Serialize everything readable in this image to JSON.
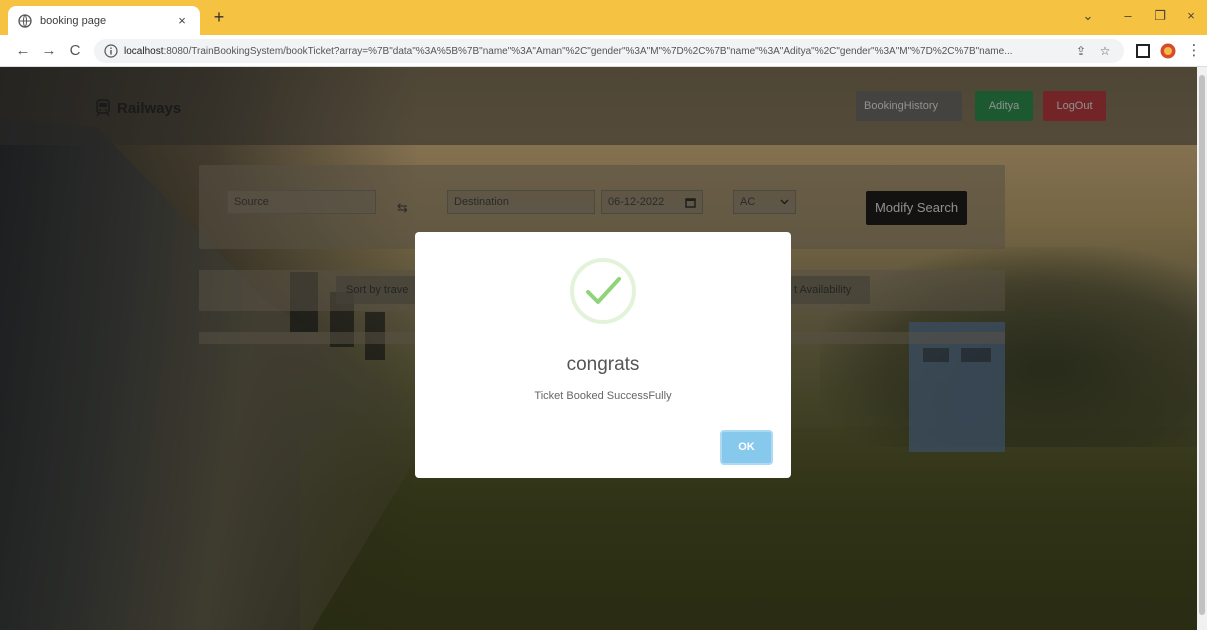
{
  "browser": {
    "tab_title": "booking page",
    "tab_close": "×",
    "new_tab": "+",
    "win_dropdown": "⌄",
    "win_minimize": "–",
    "win_restore": "❐",
    "win_close": "×",
    "nav_back": "←",
    "nav_forward": "→",
    "nav_reload": "C",
    "url_host": "localhost",
    "url_rest": ":8080/TrainBookingSystem/bookTicket?array=%7B\"data\"%3A%5B%7B\"name\"%3A\"Aman\"%2C\"gender\"%3A\"M\"%7D%2C%7B\"name\"%3A\"Aditya\"%2C\"gender\"%3A\"M\"%7D%2C%7B\"name...",
    "share_icon": "⇪",
    "bookmark_icon": "☆",
    "menu_icon": "⋮"
  },
  "navbar": {
    "brand": "Railways",
    "booking_history": "BookingHistory",
    "user": "Aditya",
    "logout": "LogOut"
  },
  "search": {
    "source_placeholder": "Source",
    "swap_icon": "⇆",
    "destination_placeholder": "Destination",
    "date_value": "06-12-2022",
    "class_value": "AC",
    "modify_button": "Modify Search"
  },
  "sort": {
    "travel_label": "Sort by trave",
    "availability_label": "t Availability"
  },
  "modal": {
    "title": "congrats",
    "message": "Ticket Booked SuccessFully",
    "ok_button": "OK"
  },
  "colors": {
    "tab_bar": "#f5c242",
    "booking_history_bg": "#6f6c66",
    "user_bg": "#2e8f4e",
    "logout_bg": "#b83a3f",
    "ok_button_bg": "#87c9ec",
    "check_green": "#8fd37a"
  }
}
